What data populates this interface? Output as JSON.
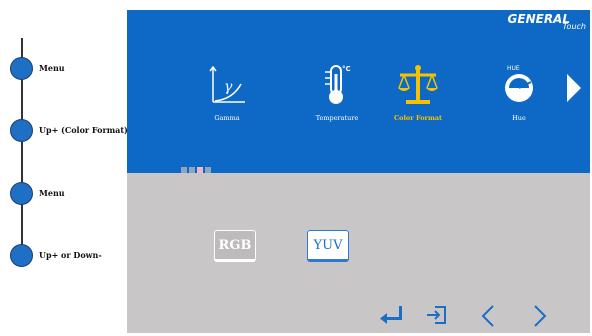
{
  "steps": [
    {
      "label": "Menu"
    },
    {
      "label": "Up+ (Color Format)"
    },
    {
      "label": "Menu"
    },
    {
      "label": "Up+ or Down-"
    }
  ],
  "brand": {
    "name": "GENERAL",
    "sub": "Touch"
  },
  "menu": {
    "items": [
      {
        "label": "Gamma",
        "icon": "gamma-curve-icon"
      },
      {
        "label": "Temperature",
        "icon": "thermometer-icon",
        "icon_text": "°C"
      },
      {
        "label": "Color Format",
        "icon": "scale-icon",
        "selected": true
      },
      {
        "label": "Hue",
        "icon": "hue-gauge-icon",
        "icon_text": "HUE"
      }
    ],
    "gamma_symbol": "γ",
    "pages": 4,
    "current_page": 3
  },
  "formats": {
    "rgb": "RGB",
    "yuv": "YUV",
    "selected": "YUV"
  },
  "nav": [
    "enter-icon",
    "exit-icon",
    "left-arrow-icon",
    "right-arrow-icon"
  ],
  "colors": {
    "panel_blue": "#0d69c5",
    "panel_grey": "#c9c6c7",
    "selected_yellow": "#f6c200",
    "step_dot": "#1f6fc4"
  }
}
